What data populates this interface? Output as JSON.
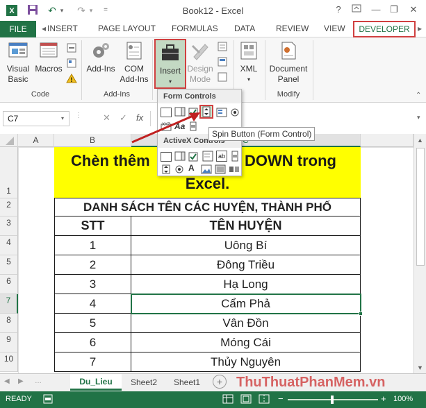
{
  "window": {
    "title": "Book12 - Excel",
    "help": "?"
  },
  "tabs": [
    "FILE",
    "INSERT",
    "PAGE LAYOUT",
    "FORMULAS",
    "DATA",
    "REVIEW",
    "VIEW",
    "DEVELOPER"
  ],
  "ribbon": {
    "visual_basic": "Visual Basic",
    "macros": "Macros",
    "group_code": "Code",
    "add_ins": "Add-Ins",
    "com_add_ins": "COM Add-Ins",
    "group_addins": "Add-Ins",
    "insert": "Insert",
    "design_mode": "Design Mode",
    "xml": "XML",
    "document_panel": "Document Panel",
    "group_modify": "Modify"
  },
  "dropdown": {
    "form_controls": "Form Controls",
    "activex_controls": "ActiveX Controls",
    "tooltip": "Spin Button (Form Control)"
  },
  "formula_bar": {
    "name_box": "C7",
    "fx": "fx"
  },
  "columns": [
    "A",
    "B",
    "C"
  ],
  "rows": [
    "1",
    "2",
    "3",
    "4",
    "5",
    "6",
    "7",
    "8",
    "9",
    "10"
  ],
  "sheet": {
    "banner_line1": "Chèn thêm",
    "banner_line1b": "DOWN trong",
    "banner_line2": "Excel.",
    "list_title": "DANH SÁCH TÊN CÁC HUYỆN, THÀNH PHỐ",
    "header_stt": "STT",
    "header_name": "TÊN HUYỆN",
    "data": [
      {
        "stt": "1",
        "name": "Uông Bí"
      },
      {
        "stt": "2",
        "name": "Đông Triều"
      },
      {
        "stt": "3",
        "name": "Hạ Long"
      },
      {
        "stt": "4",
        "name": "Cẩm Phả"
      },
      {
        "stt": "5",
        "name": "Vân Đồn"
      },
      {
        "stt": "6",
        "name": "Móng Cái"
      },
      {
        "stt": "7",
        "name": "Thủy Nguyên"
      }
    ]
  },
  "sheet_tabs": [
    "Du_Lieu",
    "Sheet2",
    "Sheet1"
  ],
  "watermark": "ThuThuatPhanMem.vn",
  "status": {
    "ready": "READY",
    "zoom": "100%"
  },
  "colors": {
    "excel_green": "#217346",
    "banner_yellow": "#ffff00",
    "highlight_red": "#d04040"
  }
}
